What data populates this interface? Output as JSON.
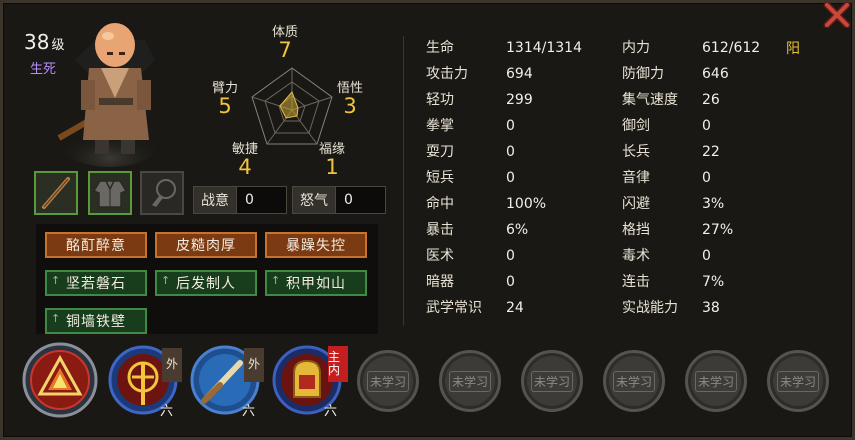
{
  "window": {
    "close_icon": "close-x-icon"
  },
  "character": {
    "level": "38",
    "level_unit": "级",
    "title": "生死",
    "portrait_icon": "monk-portrait-icon"
  },
  "attributes": {
    "constitution": {
      "label": "体质",
      "value": "7"
    },
    "strength": {
      "label": "臂力",
      "value": "5"
    },
    "insight": {
      "label": "悟性",
      "value": "3"
    },
    "agility": {
      "label": "敏捷",
      "value": "4"
    },
    "fortune": {
      "label": "福缘",
      "value": "1"
    }
  },
  "equipment": [
    {
      "icon": "staff-icon",
      "equipped": true
    },
    {
      "icon": "robe-icon",
      "equipped": true
    },
    {
      "icon": "accessory-empty-icon",
      "equipped": false
    }
  ],
  "meters": {
    "fighting_spirit": {
      "label": "战意",
      "value": "0"
    },
    "rage": {
      "label": "怒气",
      "value": "0"
    }
  },
  "traits": [
    {
      "label": "酩酊醉意",
      "style": "red"
    },
    {
      "label": "皮糙肉厚",
      "style": "red"
    },
    {
      "label": "暴躁失控",
      "style": "red"
    },
    {
      "label": "坚若磐石",
      "style": "green"
    },
    {
      "label": "后发制人",
      "style": "green"
    },
    {
      "label": "积甲如山",
      "style": "green"
    },
    {
      "label": "铜墙铁壁",
      "style": "green"
    }
  ],
  "stats_left": [
    {
      "label": "生命",
      "value": "1314/1314"
    },
    {
      "label": "攻击力",
      "value": "694"
    },
    {
      "label": "轻功",
      "value": "299"
    },
    {
      "label": "拳掌",
      "value": "0"
    },
    {
      "label": "耍刀",
      "value": "0"
    },
    {
      "label": "短兵",
      "value": "0"
    },
    {
      "label": "命中",
      "value": "100%"
    },
    {
      "label": "暴击",
      "value": "6%"
    },
    {
      "label": "医术",
      "value": "0"
    },
    {
      "label": "暗器",
      "value": "0"
    },
    {
      "label": "武学常识",
      "value": "24"
    }
  ],
  "stats_right": [
    {
      "label": "内力",
      "value": "612/612"
    },
    {
      "label": "防御力",
      "value": "646"
    },
    {
      "label": "集气速度",
      "value": "26"
    },
    {
      "label": "御剑",
      "value": "0"
    },
    {
      "label": "长兵",
      "value": "22"
    },
    {
      "label": "音律",
      "value": "0"
    },
    {
      "label": "闪避",
      "value": "3%"
    },
    {
      "label": "格挡",
      "value": "27%"
    },
    {
      "label": "毒术",
      "value": "0"
    },
    {
      "label": "连击",
      "value": "7%"
    },
    {
      "label": "实战能力",
      "value": "38"
    }
  ],
  "yin_yang": "阳",
  "skills": [
    {
      "icon": "flame-aura-skill-icon",
      "tag": "",
      "tier": ""
    },
    {
      "icon": "golden-cudgel-skill-icon",
      "tag": "外",
      "tier": "六"
    },
    {
      "icon": "staff-strike-skill-icon",
      "tag": "外",
      "tier": "六"
    },
    {
      "icon": "golden-bell-skill-icon",
      "tag": "主内",
      "tier": "六"
    }
  ],
  "locked_skill_label": "未学习",
  "locked_skill_count": 6
}
